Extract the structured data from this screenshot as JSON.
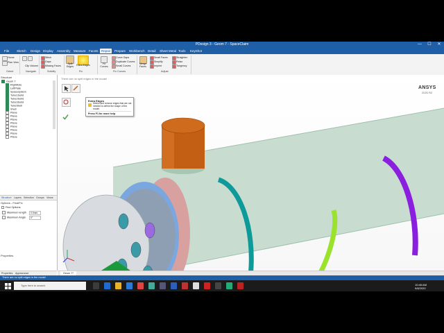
{
  "window": {
    "title": "PDesign 3 - Geom 7 - SpaceClaim",
    "controls": [
      "—",
      "☐",
      "✕"
    ]
  },
  "menu": {
    "items": [
      "File",
      "Sketch",
      "Design",
      "Display",
      "Assembly",
      "Measure",
      "Facets",
      "Repair",
      "Prepare",
      "Workbench",
      "Detail",
      "Sheet Metal",
      "Tools",
      "KeyShot"
    ],
    "active": "Repair"
  },
  "ribbon": {
    "groups": [
      "Orient",
      "Navigate",
      "Solidify",
      "Fix",
      "Fix Curves",
      "Adjust"
    ],
    "buttons": {
      "home": "Home",
      "plan_view": "Plan View",
      "clip_volume": "Clip Volume",
      "stitch": "Stitch",
      "gaps": "Gaps",
      "missing_faces": "Missing Faces",
      "split_edges": "Split Edges",
      "extra_edges": "Extra Edges",
      "fit_curves": "Fit Curves",
      "curve_gaps": "Curve Gaps",
      "duplicate_curves": "Duplicate Curves",
      "small_curves": "Small Curves",
      "merge_faces": "Merge Faces",
      "small_faces": "Small Faces",
      "simplify": "Simplify",
      "imprint": "Imprint",
      "relax": "Relax",
      "straighten": "Straighten",
      "tangency": "Tangency"
    }
  },
  "tooltip": {
    "title": "Extra Edges",
    "description": "Detect and remove edges that are not needed to define the shape of the model.",
    "help": "Press F1 for more help."
  },
  "structure": {
    "header": "Structure",
    "root": "Geom 7",
    "items": [
      "RightAxle",
      "LeftPlate",
      "Spacesystem",
      "Tube1Solid",
      "Tube2Solid",
      "Tube3Solid",
      "TubeShell",
      "Shell",
      "Plane",
      "Plane",
      "Plane",
      "Plane",
      "Plane",
      "Plane",
      "Plane",
      "Plane"
    ]
  },
  "panel_tabs": [
    "Structure",
    "Layers",
    "Selection",
    "Groups",
    "Views"
  ],
  "options": {
    "header": "Options - Find/Fix",
    "find_options": "Find Options",
    "max_length_label": "Maximum length",
    "max_length_value": "0.5mm",
    "max_angle_label": "Maximum Angle",
    "max_angle_value": "0°"
  },
  "properties": {
    "header": "Properties",
    "tabs": [
      "Properties",
      "Appearance"
    ]
  },
  "viewport": {
    "message": "There are no split edges in the model",
    "brand": "ANSYS",
    "version": "2020 R2",
    "tab": "Geom 7*"
  },
  "status": {
    "text": "There are no split edges in the model"
  },
  "taskbar": {
    "search_placeholder": "Type here to search",
    "time": "10:48 AM",
    "date": "9/8/2020"
  },
  "colors": {
    "accent": "#1f5fa8",
    "body_main": "#c8ddd0",
    "ring_teal": "#0f9a9a",
    "ring_lime": "#9be22d",
    "ring_purple": "#8a1fe0",
    "nozzle": "#c25f14",
    "cap_blue": "#7aa7e0",
    "cap_pink": "#d9a0a0"
  }
}
